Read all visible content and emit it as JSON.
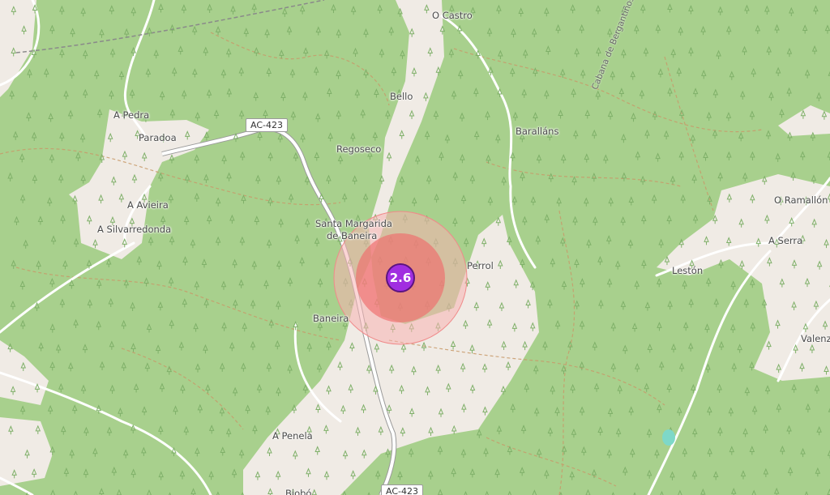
{
  "map": {
    "colors": {
      "forest": "#a8d08d",
      "clearing": "#f0ebe5",
      "road": "#ffffff",
      "track": "#c89a6a",
      "ring_outer": "#f8b3b3",
      "ring_inner": "#ef6b6b",
      "marker": "#a12ee0"
    },
    "event_marker": {
      "magnitude": "2.6"
    },
    "road_shields": {
      "ac423_north": "AC-423",
      "ac423_south": "AC-423"
    },
    "road_names": {
      "cabana": "Cabana de Bergantiños"
    },
    "places": {
      "o_castro": "O Castro",
      "bello": "Bello",
      "a_pedra": "A Pedra",
      "paradoa": "Paradoa",
      "regoseco": "Regoseco",
      "barallans": "Baralláns",
      "a_avieira": "A Avieira",
      "a_silvarredonda": "A Silvarredonda",
      "santa_margarida": "Santa Margarida",
      "de_baneira": "de Baneira",
      "o_ramallon": "O Ramallón",
      "a_serra": "A Serra",
      "perrol": "Perrol",
      "leston": "Lestón",
      "baneira": "Baneira",
      "valenza": "Valenza",
      "a_penela": "A Penela",
      "biobo": "Biobó"
    }
  }
}
